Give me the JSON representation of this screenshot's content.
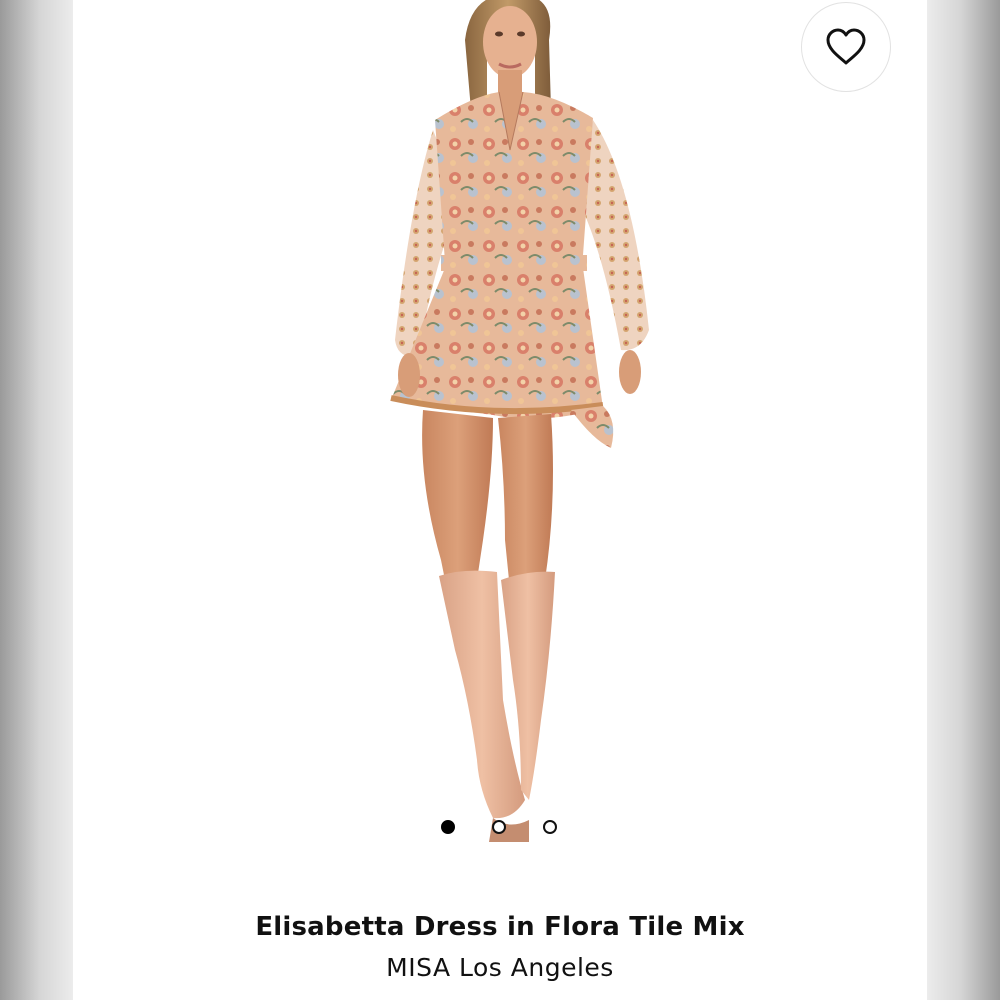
{
  "product": {
    "name": "Elisabetta Dress in Flora Tile Mix",
    "brand": "MISA Los Angeles"
  },
  "gallery": {
    "image_count": 3,
    "active_index": 0
  },
  "icons": {
    "favorite": "heart-outline-icon"
  },
  "colors": {
    "page_background": "#ffffff",
    "dot_active": "#000000",
    "boot": "#e8b597",
    "dress": "#e7b99a"
  }
}
